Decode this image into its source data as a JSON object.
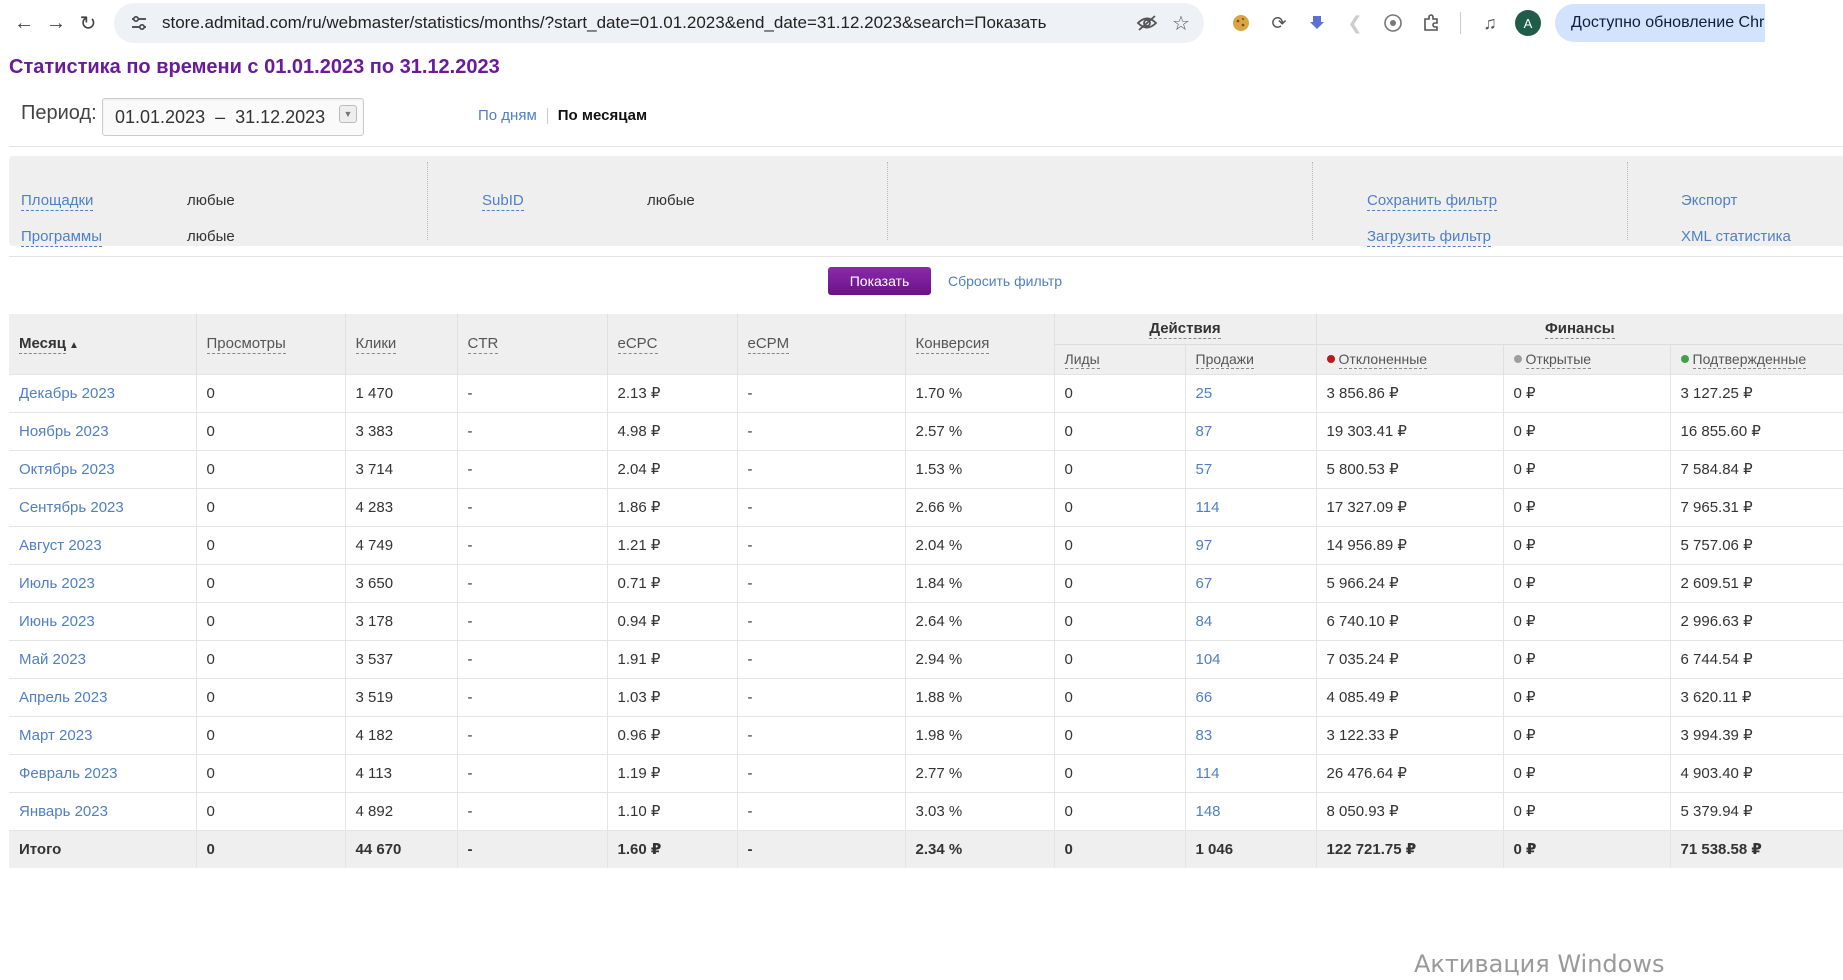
{
  "browser": {
    "url": "store.admitad.com/ru/webmaster/statistics/months/?start_date=01.01.2023&end_date=31.12.2023&search=Показать",
    "avatar_letter": "A",
    "update_label": "Доступно обновление Chrome"
  },
  "page": {
    "title": "Статистика по времени с 01.01.2023 по 31.12.2023",
    "period_label": "Период:",
    "date_from": "01.01.2023",
    "date_sep": "–",
    "date_to": "31.12.2023",
    "by_days": "По дням",
    "by_months": "По месяцам"
  },
  "filter": {
    "platforms_label": "Площадки",
    "platforms_value": "любые",
    "programs_label": "Программы",
    "programs_value": "любые",
    "subid_label": "SubID",
    "subid_value": "любые",
    "save_filter": "Сохранить фильтр",
    "load_filter": "Загрузить фильтр",
    "export": "Экспорт",
    "xml_stats": "XML статистика",
    "show_button": "Показать",
    "reset_filter": "Сбросить фильтр"
  },
  "table": {
    "headers": {
      "month": "Месяц",
      "views": "Просмотры",
      "clicks": "Клики",
      "ctr": "CTR",
      "ecpc": "eCPC",
      "ecpm": "eCPM",
      "conversion": "Конверсия",
      "actions": "Действия",
      "leads": "Лиды",
      "sales": "Продажи",
      "finance": "Финансы",
      "rejected": "Отклоненные",
      "open": "Открытые",
      "confirmed": "Подтвержденные"
    },
    "status_colors": {
      "rejected": "#b71c1c",
      "open": "#9e9e9e",
      "confirmed": "#43a047"
    },
    "rows": [
      {
        "month": "Декабрь 2023",
        "views": "0",
        "clicks": "1 470",
        "ctr": "-",
        "ecpc": "2.13 ₽",
        "ecpm": "-",
        "conv": "1.70 %",
        "leads": "0",
        "sales": "25",
        "rejected": "3 856.86 ₽",
        "open": "0 ₽",
        "confirmed": "3 127.25 ₽"
      },
      {
        "month": "Ноябрь 2023",
        "views": "0",
        "clicks": "3 383",
        "ctr": "-",
        "ecpc": "4.98 ₽",
        "ecpm": "-",
        "conv": "2.57 %",
        "leads": "0",
        "sales": "87",
        "rejected": "19 303.41 ₽",
        "open": "0 ₽",
        "confirmed": "16 855.60 ₽"
      },
      {
        "month": "Октябрь 2023",
        "views": "0",
        "clicks": "3 714",
        "ctr": "-",
        "ecpc": "2.04 ₽",
        "ecpm": "-",
        "conv": "1.53 %",
        "leads": "0",
        "sales": "57",
        "rejected": "5 800.53 ₽",
        "open": "0 ₽",
        "confirmed": "7 584.84 ₽"
      },
      {
        "month": "Сентябрь 2023",
        "views": "0",
        "clicks": "4 283",
        "ctr": "-",
        "ecpc": "1.86 ₽",
        "ecpm": "-",
        "conv": "2.66 %",
        "leads": "0",
        "sales": "114",
        "rejected": "17 327.09 ₽",
        "open": "0 ₽",
        "confirmed": "7 965.31 ₽"
      },
      {
        "month": "Август 2023",
        "views": "0",
        "clicks": "4 749",
        "ctr": "-",
        "ecpc": "1.21 ₽",
        "ecpm": "-",
        "conv": "2.04 %",
        "leads": "0",
        "sales": "97",
        "rejected": "14 956.89 ₽",
        "open": "0 ₽",
        "confirmed": "5 757.06 ₽"
      },
      {
        "month": "Июль 2023",
        "views": "0",
        "clicks": "3 650",
        "ctr": "-",
        "ecpc": "0.71 ₽",
        "ecpm": "-",
        "conv": "1.84 %",
        "leads": "0",
        "sales": "67",
        "rejected": "5 966.24 ₽",
        "open": "0 ₽",
        "confirmed": "2 609.51 ₽"
      },
      {
        "month": "Июнь 2023",
        "views": "0",
        "clicks": "3 178",
        "ctr": "-",
        "ecpc": "0.94 ₽",
        "ecpm": "-",
        "conv": "2.64 %",
        "leads": "0",
        "sales": "84",
        "rejected": "6 740.10 ₽",
        "open": "0 ₽",
        "confirmed": "2 996.63 ₽"
      },
      {
        "month": "Май 2023",
        "views": "0",
        "clicks": "3 537",
        "ctr": "-",
        "ecpc": "1.91 ₽",
        "ecpm": "-",
        "conv": "2.94 %",
        "leads": "0",
        "sales": "104",
        "rejected": "7 035.24 ₽",
        "open": "0 ₽",
        "confirmed": "6 744.54 ₽"
      },
      {
        "month": "Апрель 2023",
        "views": "0",
        "clicks": "3 519",
        "ctr": "-",
        "ecpc": "1.03 ₽",
        "ecpm": "-",
        "conv": "1.88 %",
        "leads": "0",
        "sales": "66",
        "rejected": "4 085.49 ₽",
        "open": "0 ₽",
        "confirmed": "3 620.11 ₽"
      },
      {
        "month": "Март 2023",
        "views": "0",
        "clicks": "4 182",
        "ctr": "-",
        "ecpc": "0.96 ₽",
        "ecpm": "-",
        "conv": "1.98 %",
        "leads": "0",
        "sales": "83",
        "rejected": "3 122.33 ₽",
        "open": "0 ₽",
        "confirmed": "3 994.39 ₽"
      },
      {
        "month": "Февраль 2023",
        "views": "0",
        "clicks": "4 113",
        "ctr": "-",
        "ecpc": "1.19 ₽",
        "ecpm": "-",
        "conv": "2.77 %",
        "leads": "0",
        "sales": "114",
        "rejected": "26 476.64 ₽",
        "open": "0 ₽",
        "confirmed": "4 903.40 ₽"
      },
      {
        "month": "Январь 2023",
        "views": "0",
        "clicks": "4 892",
        "ctr": "-",
        "ecpc": "1.10 ₽",
        "ecpm": "-",
        "conv": "3.03 %",
        "leads": "0",
        "sales": "148",
        "rejected": "8 050.93 ₽",
        "open": "0 ₽",
        "confirmed": "5 379.94 ₽"
      }
    ],
    "total": {
      "month": "Итого",
      "views": "0",
      "clicks": "44 670",
      "ctr": "-",
      "ecpc": "1.60 ₽",
      "ecpm": "-",
      "conv": "2.34 %",
      "leads": "0",
      "sales": "1 046",
      "rejected": "122 721.75 ₽",
      "open": "0 ₽",
      "confirmed": "71 538.58 ₽"
    }
  },
  "watermark": "Активация Windows",
  "icons": [
    "back-icon",
    "forward-icon",
    "reload-icon",
    "site-settings-icon",
    "eye-off-icon",
    "star-icon",
    "cookie-icon",
    "sync-icon",
    "download-icon",
    "share-icon",
    "ext-icon",
    "puzzle-icon",
    "media-icon"
  ]
}
